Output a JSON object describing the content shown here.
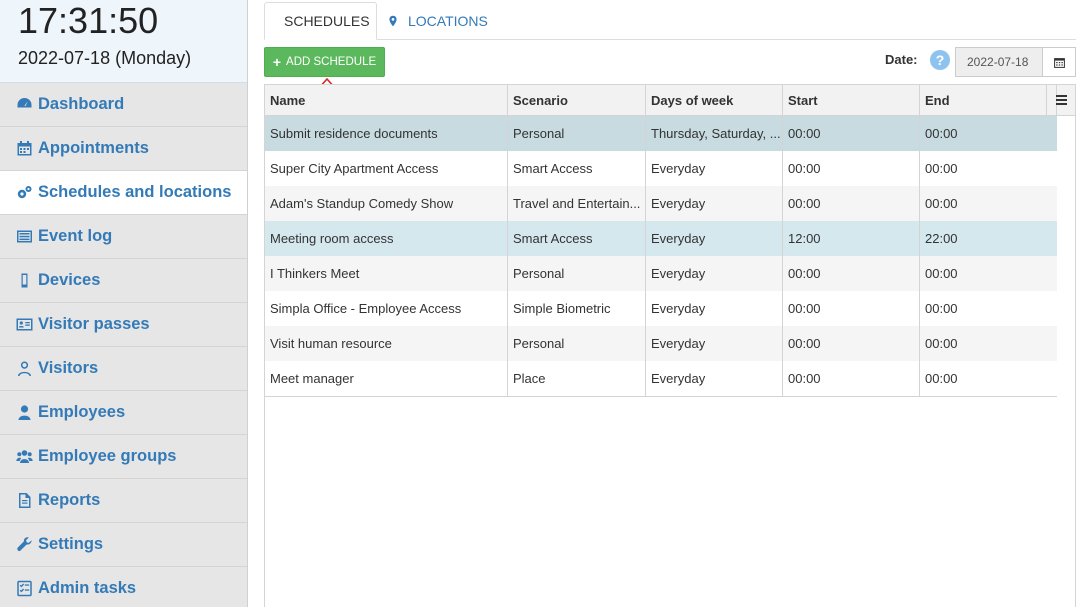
{
  "clock": {
    "time": "17:31:50",
    "date": "2022-07-18 (Monday)"
  },
  "sidebar": {
    "items": [
      {
        "label": "Dashboard",
        "icon": "dashboard-icon",
        "active": false
      },
      {
        "label": "Appointments",
        "icon": "calendar-icon",
        "active": false
      },
      {
        "label": "Schedules and locations",
        "icon": "gears-icon",
        "active": true
      },
      {
        "label": "Event log",
        "icon": "list-icon",
        "active": false
      },
      {
        "label": "Devices",
        "icon": "mobile-icon",
        "active": false
      },
      {
        "label": "Visitor passes",
        "icon": "id-card-icon",
        "active": false
      },
      {
        "label": "Visitors",
        "icon": "user-outline-icon",
        "active": false
      },
      {
        "label": "Employees",
        "icon": "user-icon",
        "active": false
      },
      {
        "label": "Employee groups",
        "icon": "users-icon",
        "active": false
      },
      {
        "label": "Reports",
        "icon": "file-icon",
        "active": false
      },
      {
        "label": "Settings",
        "icon": "wrench-icon",
        "active": false
      },
      {
        "label": "Admin tasks",
        "icon": "tasks-icon",
        "active": false
      }
    ]
  },
  "tabs": [
    {
      "label": "SCHEDULES",
      "icon": "clock-icon",
      "active": true
    },
    {
      "label": "LOCATIONS",
      "icon": "map-marker-icon",
      "active": false
    }
  ],
  "toolbar": {
    "add_label": "ADD SCHEDULE",
    "date_label": "Date:",
    "help": "?",
    "date_value": "2022-07-18"
  },
  "colors": {
    "accent": "#337ab7",
    "add_button": "#5cb85c",
    "arrow": "#d9262c",
    "selected_row": "#c8dbe0"
  },
  "grid": {
    "columns": [
      "Name",
      "Scenario",
      "Days of week",
      "Start",
      "End"
    ],
    "rows": [
      {
        "name": "Submit residence documents",
        "scenario": "Personal",
        "days": "Thursday, Saturday, ...",
        "start": "00:00",
        "end": "00:00",
        "state": "selected"
      },
      {
        "name": "Super City Apartment Access",
        "scenario": "Smart Access",
        "days": "Everyday",
        "start": "00:00",
        "end": "00:00",
        "state": "even"
      },
      {
        "name": "Adam's Standup Comedy Show",
        "scenario": "Travel and Entertain...",
        "days": "Everyday",
        "start": "00:00",
        "end": "00:00",
        "state": "odd"
      },
      {
        "name": "Meeting room access",
        "scenario": "Smart Access",
        "days": "Everyday",
        "start": "12:00",
        "end": "22:00",
        "state": "highlight"
      },
      {
        "name": "I Thinkers Meet",
        "scenario": "Personal",
        "days": "Everyday",
        "start": "00:00",
        "end": "00:00",
        "state": "odd"
      },
      {
        "name": "Simpla Office - Employee Access",
        "scenario": "Simple Biometric",
        "days": "Everyday",
        "start": "00:00",
        "end": "00:00",
        "state": "even"
      },
      {
        "name": "Visit human resource",
        "scenario": "Personal",
        "days": "Everyday",
        "start": "00:00",
        "end": "00:00",
        "state": "odd"
      },
      {
        "name": "Meet manager",
        "scenario": "Place",
        "days": "Everyday",
        "start": "00:00",
        "end": "00:00",
        "state": "even"
      }
    ]
  }
}
